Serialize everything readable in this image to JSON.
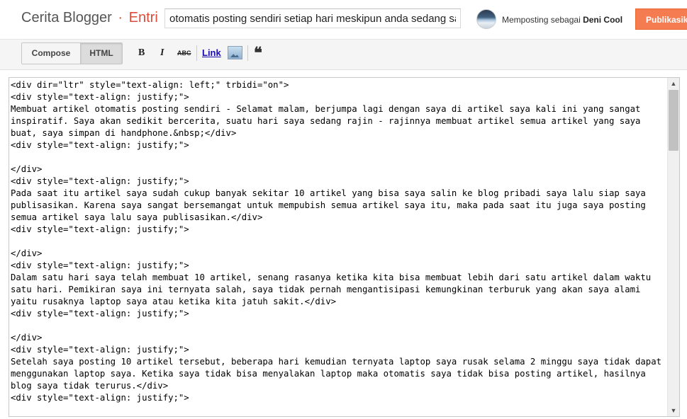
{
  "header": {
    "blog_name": "Cerita Blogger",
    "separator": "·",
    "section": "Entri",
    "post_title": "otomatis posting sendiri setiap hari meskipun anda sedang sakit",
    "posting_as_prefix": "Memposting sebagai",
    "user_name": "Deni Cool",
    "publish_label": "Publikasikan"
  },
  "toolbar": {
    "compose_label": "Compose",
    "html_label": "HTML",
    "bold_glyph": "B",
    "italic_glyph": "I",
    "strike_glyph": "ABC",
    "link_label": "Link",
    "quote_glyph": "❝"
  },
  "editor": {
    "lines": [
      "<div dir=\"ltr\" style=\"text-align: left;\" trbidi=\"on\">",
      "<div style=\"text-align: justify;\">",
      "Membuat artikel otomatis posting sendiri - Selamat malam, berjumpa lagi dengan saya di artikel saya kali ini yang sangat inspiratif. Saya akan sedikit bercerita, suatu hari saya sedang rajin - rajinnya membuat artikel semua artikel yang saya buat, saya simpan di handphone.&nbsp;</div>",
      "<div style=\"text-align: justify;\">",
      "",
      "</div>",
      "<div style=\"text-align: justify;\">",
      "Pada saat itu artikel saya sudah cukup banyak sekitar 10 artikel yang bisa saya salin ke blog pribadi saya lalu siap saya publisasikan. Karena saya sangat bersemangat untuk mempubish semua artikel saya itu, maka pada saat itu juga saya posting semua artikel saya lalu saya publisasikan.</div>",
      "<div style=\"text-align: justify;\">",
      "",
      "</div>",
      "<div style=\"text-align: justify;\">",
      "Dalam satu hari saya telah membuat 10 artikel, senang rasanya ketika kita bisa membuat lebih dari satu artikel dalam waktu satu hari. Pemikiran saya ini ternyata salah, saya tidak pernah mengantisipasi kemungkinan terburuk yang akan saya alami yaitu rusaknya laptop saya atau ketika kita jatuh sakit.</div>",
      "<div style=\"text-align: justify;\">",
      "",
      "</div>",
      "<div style=\"text-align: justify;\">",
      "Setelah saya posting 10 artikel tersebut, beberapa hari kemudian ternyata laptop saya rusak selama 2 minggu saya tidak dapat menggunakan laptop saya. Ketika saya tidak bisa menyalakan laptop maka otomatis saya tidak bisa posting artikel, hasilnya blog saya tidak terurus.</div>",
      "<div style=\"text-align: justify;\">"
    ]
  }
}
